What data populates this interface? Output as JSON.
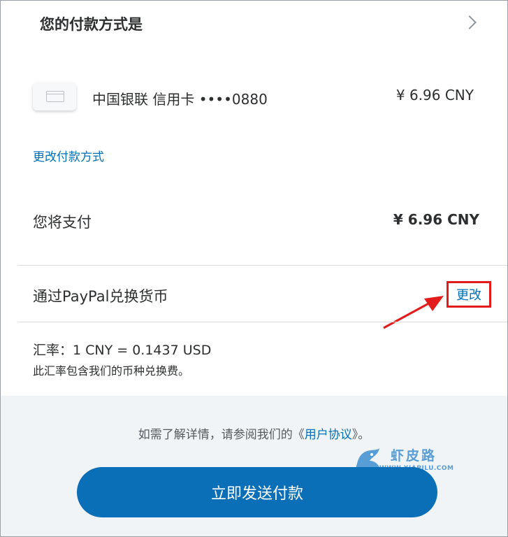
{
  "header": {
    "title": "您的付款方式是"
  },
  "payment_method": {
    "card_label": "中国银联 信用卡 ••••0880",
    "amount": "¥ 6.96 CNY",
    "change_link": "更改付款方式"
  },
  "total": {
    "label": "您将支付",
    "amount": "¥ 6.96 CNY"
  },
  "conversion": {
    "label": "通过PayPal兑换货币",
    "change_link": "更改",
    "rate": "汇率：1 CNY = 0.1437 USD",
    "note": "此汇率包含我们的币种兑换费。"
  },
  "footer": {
    "agreement_prefix": "如需了解详情，请参阅我们的《",
    "agreement_link": "用户协议",
    "agreement_suffix": "》。",
    "pay_button": "立即发送付款"
  },
  "watermark": {
    "text": "虾皮路",
    "sub": "WWW.XIAPILU.COM"
  },
  "colors": {
    "link": "#0070ba",
    "button": "#0b6fb8",
    "highlight": "#e31b1b",
    "footer_bg": "#f0f4f7"
  }
}
